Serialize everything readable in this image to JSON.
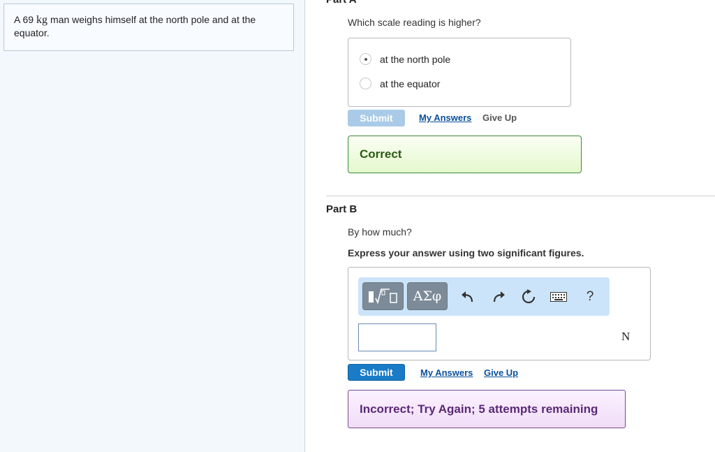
{
  "problem": {
    "text_before": "A 69",
    "unit": "kg",
    "text_after": "man weighs himself at the north pole and at the equator."
  },
  "part_a": {
    "header": "Part A",
    "question": "Which scale reading is higher?",
    "options": [
      {
        "label": "at the north pole",
        "selected": true
      },
      {
        "label": "at the equator",
        "selected": false
      }
    ],
    "submit_label": "Submit",
    "my_answers_label": "My Answers",
    "give_up_label": "Give Up",
    "feedback": "Correct"
  },
  "part_b": {
    "header": "Part B",
    "question": "By how much?",
    "instruction": "Express your answer using two significant figures.",
    "toolbar": {
      "greek_label": "ΑΣφ",
      "help_label": "?",
      "icons": [
        "templates-icon",
        "greek-symbols-icon",
        "undo-icon",
        "redo-icon",
        "reset-icon",
        "keyboard-icon",
        "help-icon"
      ]
    },
    "answer_value": "",
    "unit": "N",
    "submit_label": "Submit",
    "my_answers_label": "My Answers",
    "give_up_label": "Give Up",
    "feedback": "Incorrect; Try Again; 5 attempts remaining"
  },
  "colors": {
    "correct_border": "#3c8a3c",
    "incorrect_border": "#7a4a8e",
    "submit_active": "#1a7bc7",
    "submit_disabled": "#a9cbe7",
    "link": "#0a4f9c"
  }
}
